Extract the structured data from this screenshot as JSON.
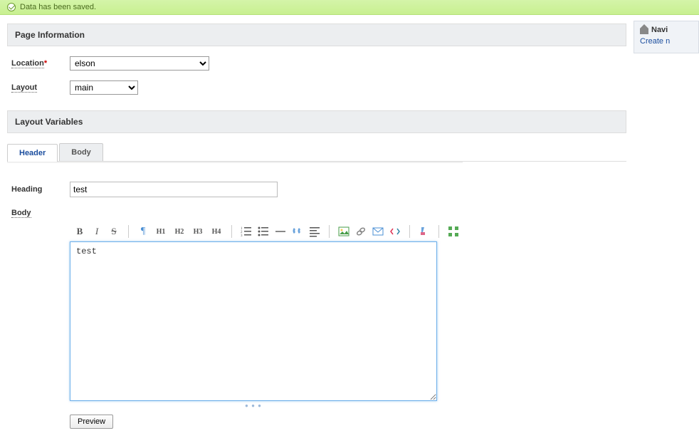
{
  "alert": {
    "message": "Data has been saved."
  },
  "sidebar": {
    "title": "Navi",
    "link_label": "Create n"
  },
  "sections": {
    "page_info": "Page Information",
    "layout_vars": "Layout Variables"
  },
  "form": {
    "location_label": "Location",
    "location_value": "elson",
    "layout_label": "Layout",
    "layout_value": "main",
    "heading_label": "Heading",
    "heading_value": "test",
    "body_label": "Body"
  },
  "tabs": {
    "header": "Header",
    "body": "Body"
  },
  "toolbar": {
    "bold": "B",
    "italic": "I",
    "strike": "S",
    "para": "¶",
    "h1": "H1",
    "h2": "H2",
    "h3": "H3",
    "h4": "H4"
  },
  "editor": {
    "content": "test"
  },
  "buttons": {
    "preview": "Preview"
  }
}
